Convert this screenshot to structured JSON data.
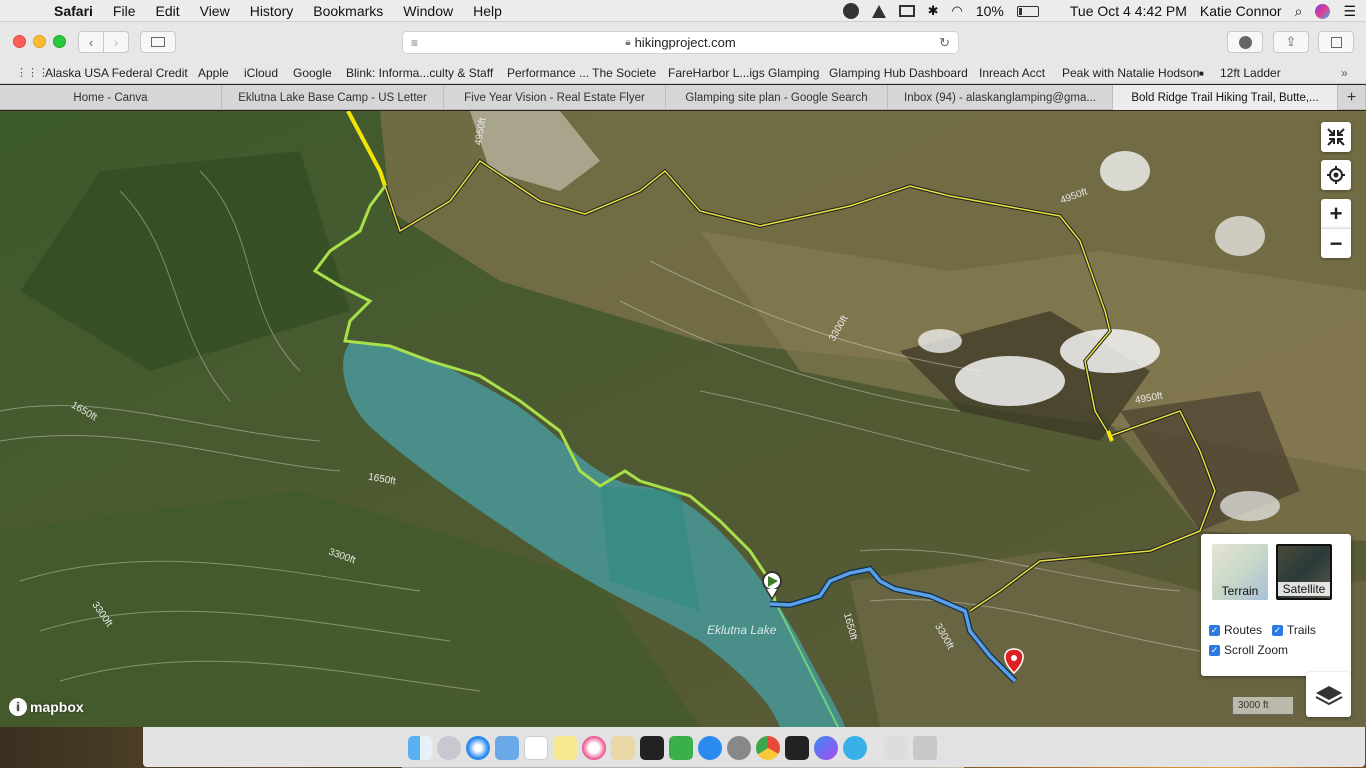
{
  "menubar": {
    "app": "Safari",
    "items": [
      "File",
      "Edit",
      "View",
      "History",
      "Bookmarks",
      "Window",
      "Help"
    ],
    "battery": "10%",
    "datetime": "Tue Oct 4  4:42 PM",
    "user": "Katie Connor"
  },
  "toolbar": {
    "url": "hikingproject.com"
  },
  "bookmarks": [
    "Alaska USA Federal Credit",
    "Apple",
    "iCloud",
    "Google",
    "Blink: Informa...culty & Staff",
    "Performance ... The Societe",
    "FareHarbor L...igs Glamping",
    "Glamping Hub Dashboard",
    "Inreach Acct",
    "Peak with Natalie Hodson",
    "12ft Ladder"
  ],
  "tabs": [
    "Home - Canva",
    "Eklutna Lake Base Camp - US Letter",
    "Five Year Vision - Real Estate Flyer",
    "Glamping site plan - Google Search",
    "Inbox (94) - alaskanglamping@gma...",
    "Bold Ridge Trail Hiking Trail, Butte,..."
  ],
  "map": {
    "lake_label": "Eklutna Lake",
    "contours": [
      "4950ft",
      "4950ft",
      "4950ft",
      "3300ft",
      "1650ft",
      "1650ft",
      "3300ft",
      "3300ft",
      "1650ft",
      "3300ft"
    ],
    "layers": {
      "terrain": "Terrain",
      "satellite": "Satellite",
      "routes": "Routes",
      "trails": "Trails",
      "scroll_zoom": "Scroll Zoom"
    },
    "scale": "3000 ft",
    "logo": "mapbox",
    "zoom_in": "+",
    "zoom_out": "−"
  },
  "colors": {
    "route": "#5aa0e8",
    "trail_yellow": "#f2e600",
    "trail_green": "#9be040",
    "lake": "#4a9a94"
  }
}
